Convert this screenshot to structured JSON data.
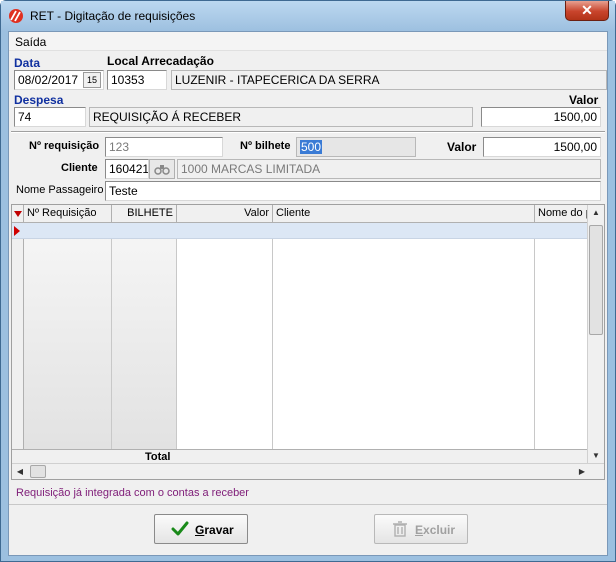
{
  "window": {
    "title": "RET - Digitação de requisições",
    "close_label": "✕"
  },
  "menu": {
    "items": [
      "Saída"
    ]
  },
  "form": {
    "data_label": "Data",
    "data_value": "08/02/2017",
    "calendar_glyph": "15",
    "local_label": "Local Arrecadação",
    "local_code": "10353",
    "local_name": "LUZENIR - ITAPECERICA DA SERRA",
    "despesa_label": "Despesa",
    "despesa_code": "74",
    "despesa_name": "REQUISIÇÃO Á RECEBER",
    "valor_label": "Valor",
    "valor_value": "1500,00",
    "requisicao_label": "Nº requisição",
    "requisicao_value": "123",
    "bilhete_label": "Nº bilhete",
    "bilhete_value": "500",
    "valor2_label": "Valor",
    "valor2_value": "1500,00",
    "cliente_label": "Cliente",
    "cliente_code": "160421",
    "cliente_name": "1000 MARCAS LIMITADA",
    "passageiro_label": "Nome Passageiro",
    "passageiro_value": "Teste"
  },
  "grid": {
    "columns": [
      "Nº Requisição",
      "BILHETE",
      "Valor",
      "Cliente",
      "Nome do pa"
    ],
    "total_label": "Total"
  },
  "status": "Requisição já integrada com o contas a receber",
  "buttons": {
    "gravar_accel": "G",
    "gravar_rest": "ravar",
    "excluir_accel": "E",
    "excluir_rest": "xcluir"
  },
  "colors": {
    "title_bar": "#9dc0e0",
    "close_button": "#c8442c",
    "label_blue": "#1030a0",
    "status_text": "#80207a",
    "selection": "#3a7bd5",
    "row_indicator": "#d00000",
    "save_check": "#1a8a1a"
  },
  "icons": {
    "app": "app-logo-icon",
    "calendar": "calendar-icon",
    "lookup": "binoculars-icon",
    "save": "checkmark-icon",
    "delete": "trash-icon"
  }
}
